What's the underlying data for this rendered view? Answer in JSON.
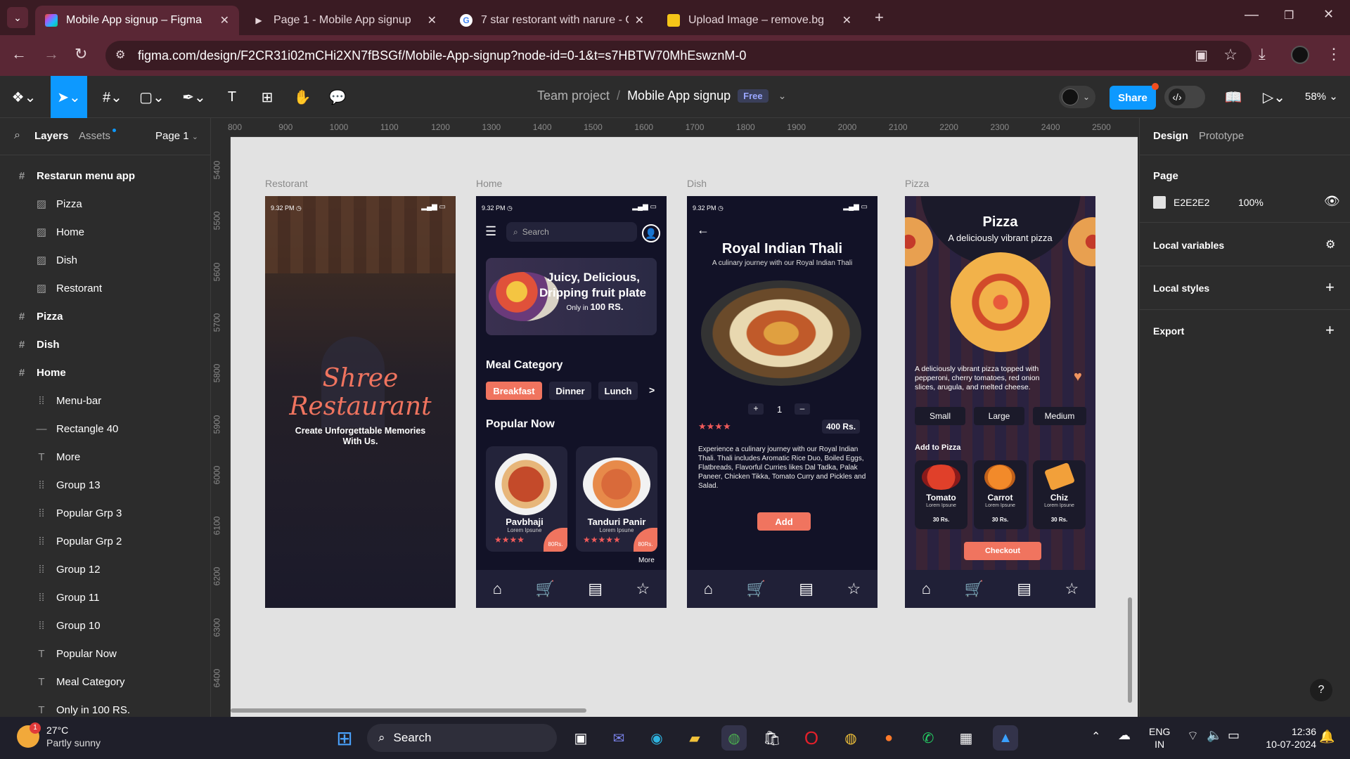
{
  "browser": {
    "tabs": [
      {
        "title": "Mobile App signup – Figma",
        "active": true
      },
      {
        "title": "Page 1 - Mobile App signup",
        "active": false
      },
      {
        "title": "7 star restorant with narure - G",
        "active": false
      },
      {
        "title": "Upload Image – remove.bg",
        "active": false
      }
    ],
    "url": "figma.com/design/F2CR31i02mCHi2XN7fBSGf/Mobile-App-signup?node-id=0-1&t=s7HBTW70MhEswznM-0"
  },
  "figma": {
    "breadcrumb_team": "Team project",
    "breadcrumb_sep": "/",
    "file_name": "Mobile App signup",
    "plan_badge": "Free",
    "share_label": "Share",
    "zoom": "58%"
  },
  "left_panel": {
    "tab_layers": "Layers",
    "tab_assets": "Assets",
    "page_selector": "Page 1",
    "layers": [
      {
        "name": "Restarun menu app",
        "icon": "frame-icon",
        "indent": 0
      },
      {
        "name": "Pizza",
        "icon": "image-icon",
        "indent": 1
      },
      {
        "name": "Home",
        "icon": "image-icon",
        "indent": 1
      },
      {
        "name": "Dish",
        "icon": "image-icon",
        "indent": 1
      },
      {
        "name": "Restorant",
        "icon": "image-icon",
        "indent": 1
      },
      {
        "name": "Pizza",
        "icon": "frame-icon",
        "indent": 0
      },
      {
        "name": "Dish",
        "icon": "frame-icon",
        "indent": 0
      },
      {
        "name": "Home",
        "icon": "frame-icon",
        "indent": 0
      },
      {
        "name": "Menu-bar",
        "icon": "group-icon",
        "indent": 1
      },
      {
        "name": "Rectangle 40",
        "icon": "rectangle-icon",
        "indent": 1
      },
      {
        "name": "More",
        "icon": "text-icon",
        "indent": 1
      },
      {
        "name": "Group 13",
        "icon": "group-icon",
        "indent": 1
      },
      {
        "name": "Popular Grp 3",
        "icon": "group-icon",
        "indent": 1
      },
      {
        "name": "Popular Grp 2",
        "icon": "group-icon",
        "indent": 1
      },
      {
        "name": "Group 12",
        "icon": "group-icon",
        "indent": 1
      },
      {
        "name": "Group 11",
        "icon": "group-icon",
        "indent": 1
      },
      {
        "name": "Group 10",
        "icon": "group-icon",
        "indent": 1
      },
      {
        "name": "Popular Now",
        "icon": "text-icon",
        "indent": 1
      },
      {
        "name": "Meal Category",
        "icon": "text-icon",
        "indent": 1
      },
      {
        "name": "Only in 100 RS.",
        "icon": "text-icon",
        "indent": 1
      }
    ]
  },
  "rulers": {
    "h": [
      "800",
      "900",
      "1000",
      "1100",
      "1200",
      "1300",
      "1400",
      "1500",
      "1600",
      "1700",
      "1800",
      "1900",
      "2000",
      "2100",
      "2200",
      "2300",
      "2400",
      "2500"
    ],
    "v": [
      "5400",
      "5500",
      "5600",
      "5700",
      "5800",
      "5900",
      "6000",
      "6100",
      "6200",
      "6300",
      "6400"
    ]
  },
  "right_panel": {
    "tab_design": "Design",
    "tab_prototype": "Prototype",
    "page_heading": "Page",
    "page_color": "E2E2E2",
    "page_opacity": "100%",
    "local_variables": "Local variables",
    "local_styles": "Local styles",
    "export": "Export"
  },
  "frames": {
    "restorant": {
      "label": "Restorant",
      "time": "9.32 PM",
      "brand_line1": "Shree",
      "brand_line2": "Restaurant",
      "tagline": "Create Unforgettable Memories With Us."
    },
    "home": {
      "label": "Home",
      "time": "9.32 PM",
      "search_placeholder": "Search",
      "banner_line1": "Juicy, Delicious,",
      "banner_line2": "Dripping fruit plate",
      "banner_line3_prefix": "Only in",
      "banner_line3_value": "100 RS.",
      "meal_category": "Meal Category",
      "categories": [
        "Breakfast",
        "Dinner",
        "Lunch"
      ],
      "category_next": ">",
      "popular_now": "Popular Now",
      "popular": [
        {
          "name": "Pavbhaji",
          "sub": "Lorem Ipsune",
          "price": "80Rs."
        },
        {
          "name": "Tanduri Panir",
          "sub": "Lorem Ipsune",
          "price": "80Rs."
        }
      ],
      "more": "More"
    },
    "dish": {
      "label": "Dish",
      "time": "9.32 PM",
      "title": "Royal Indian Thali",
      "subtitle": "A culinary journey with our Royal Indian Thali",
      "qty_plus": "+",
      "qty": "1",
      "qty_minus": "–",
      "price": "400 Rs.",
      "description": "Experience a culinary journey with our Royal Indian Thali. Thali includes Aromatic Rice Duo, Boiled Eggs, Flatbreads, Flavorful Curries likes Dal Tadka, Palak Paneer, Chicken Tikka, Tomato Curry and Pickles and Salad.",
      "add": "Add"
    },
    "pizza": {
      "label": "Pizza",
      "title": "Pizza",
      "subtitle": "A deliciously vibrant pizza",
      "description": "A deliciously vibrant pizza topped with pepperoni, cherry tomatoes, red onion slices, arugula, and melted cheese.",
      "sizes": [
        "Small",
        "Large",
        "Medium"
      ],
      "add_to": "Add to Pizza",
      "toppings": [
        {
          "name": "Tomato",
          "sub": "Lorem Ipsune",
          "price": "30 Rs."
        },
        {
          "name": "Carrot",
          "sub": "Lorem Ipsune",
          "price": "30 Rs."
        },
        {
          "name": "Chiz",
          "sub": "Lorem Ipsune",
          "price": "30 Rs."
        }
      ],
      "checkout": "Checkout"
    }
  },
  "taskbar": {
    "temp": "27°C",
    "weather": "Partly sunny",
    "weather_badge": "1",
    "search": "Search",
    "lang1": "ENG",
    "lang2": "IN",
    "time": "12:36",
    "date": "10-07-2024"
  },
  "colors": {
    "accent": "#f0745f",
    "figma_blue": "#0d99ff",
    "canvas": "#e2e2e2",
    "tab_bg": "#3a1b23",
    "addr_bg": "#5a2735"
  }
}
